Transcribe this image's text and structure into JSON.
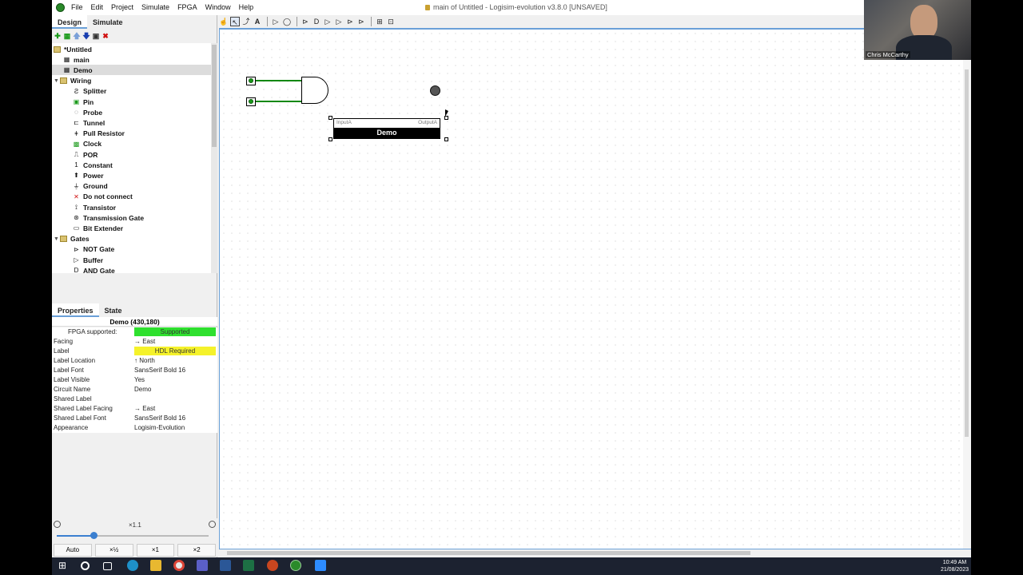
{
  "window": {
    "title": "main of Untitled - Logisim-evolution v3.8.0 [UNSAVED]"
  },
  "menu": [
    "File",
    "Edit",
    "Project",
    "Simulate",
    "FPGA",
    "Window",
    "Help"
  ],
  "tabs": {
    "design": "Design",
    "simulate": "Simulate"
  },
  "tree": {
    "root": "*Untitled",
    "circuits": [
      "main",
      "Demo"
    ],
    "selected": "Demo",
    "wiring_folder": "Wiring",
    "wiring": [
      "Splitter",
      "Pin",
      "Probe",
      "Tunnel",
      "Pull Resistor",
      "Clock",
      "POR",
      "Constant",
      "Power",
      "Ground",
      "Do not connect",
      "Transistor",
      "Transmission Gate",
      "Bit Extender"
    ],
    "gates_folder": "Gates",
    "gates": [
      "NOT Gate",
      "Buffer",
      "AND Gate",
      "OR Gate",
      "NAND Gate"
    ]
  },
  "props_tabs": {
    "properties": "Properties",
    "state": "State"
  },
  "props_title": "Demo (430,180)",
  "props": [
    {
      "key": "FPGA supported:",
      "value": "Supported"
    },
    {
      "key": "Facing",
      "value": "→ East"
    },
    {
      "key": "Label",
      "value": "HDL Required"
    },
    {
      "key": "Label Location",
      "value": "↑ North"
    },
    {
      "key": "Label Font",
      "value": "SansSerif Bold 16"
    },
    {
      "key": "Label Visible",
      "value": "Yes"
    },
    {
      "key": "Circuit Name",
      "value": "Demo"
    },
    {
      "key": "Shared Label",
      "value": ""
    },
    {
      "key": "Shared Label Facing",
      "value": "→ East"
    },
    {
      "key": "Shared Label Font",
      "value": "SansSerif Bold 16"
    },
    {
      "key": "Appearance",
      "value": "Logisim-Evolution"
    }
  ],
  "zoom": {
    "label": "×1.1",
    "level": 0.24,
    "buttons": [
      "Auto",
      "×½",
      "×1",
      "×2"
    ]
  },
  "canvas": {
    "subcircuit_label": "Demo",
    "input_port": "InputA",
    "output_port": "OutputA"
  },
  "webcam": {
    "name": "Chris McCarthy"
  },
  "clock": {
    "time": "10:49 AM",
    "date": "21/08/2023"
  },
  "colors": {
    "accent": "#6aa0d8",
    "wire": "#118811",
    "supported": "#2ee02e",
    "hdl": "#f5f22a"
  }
}
